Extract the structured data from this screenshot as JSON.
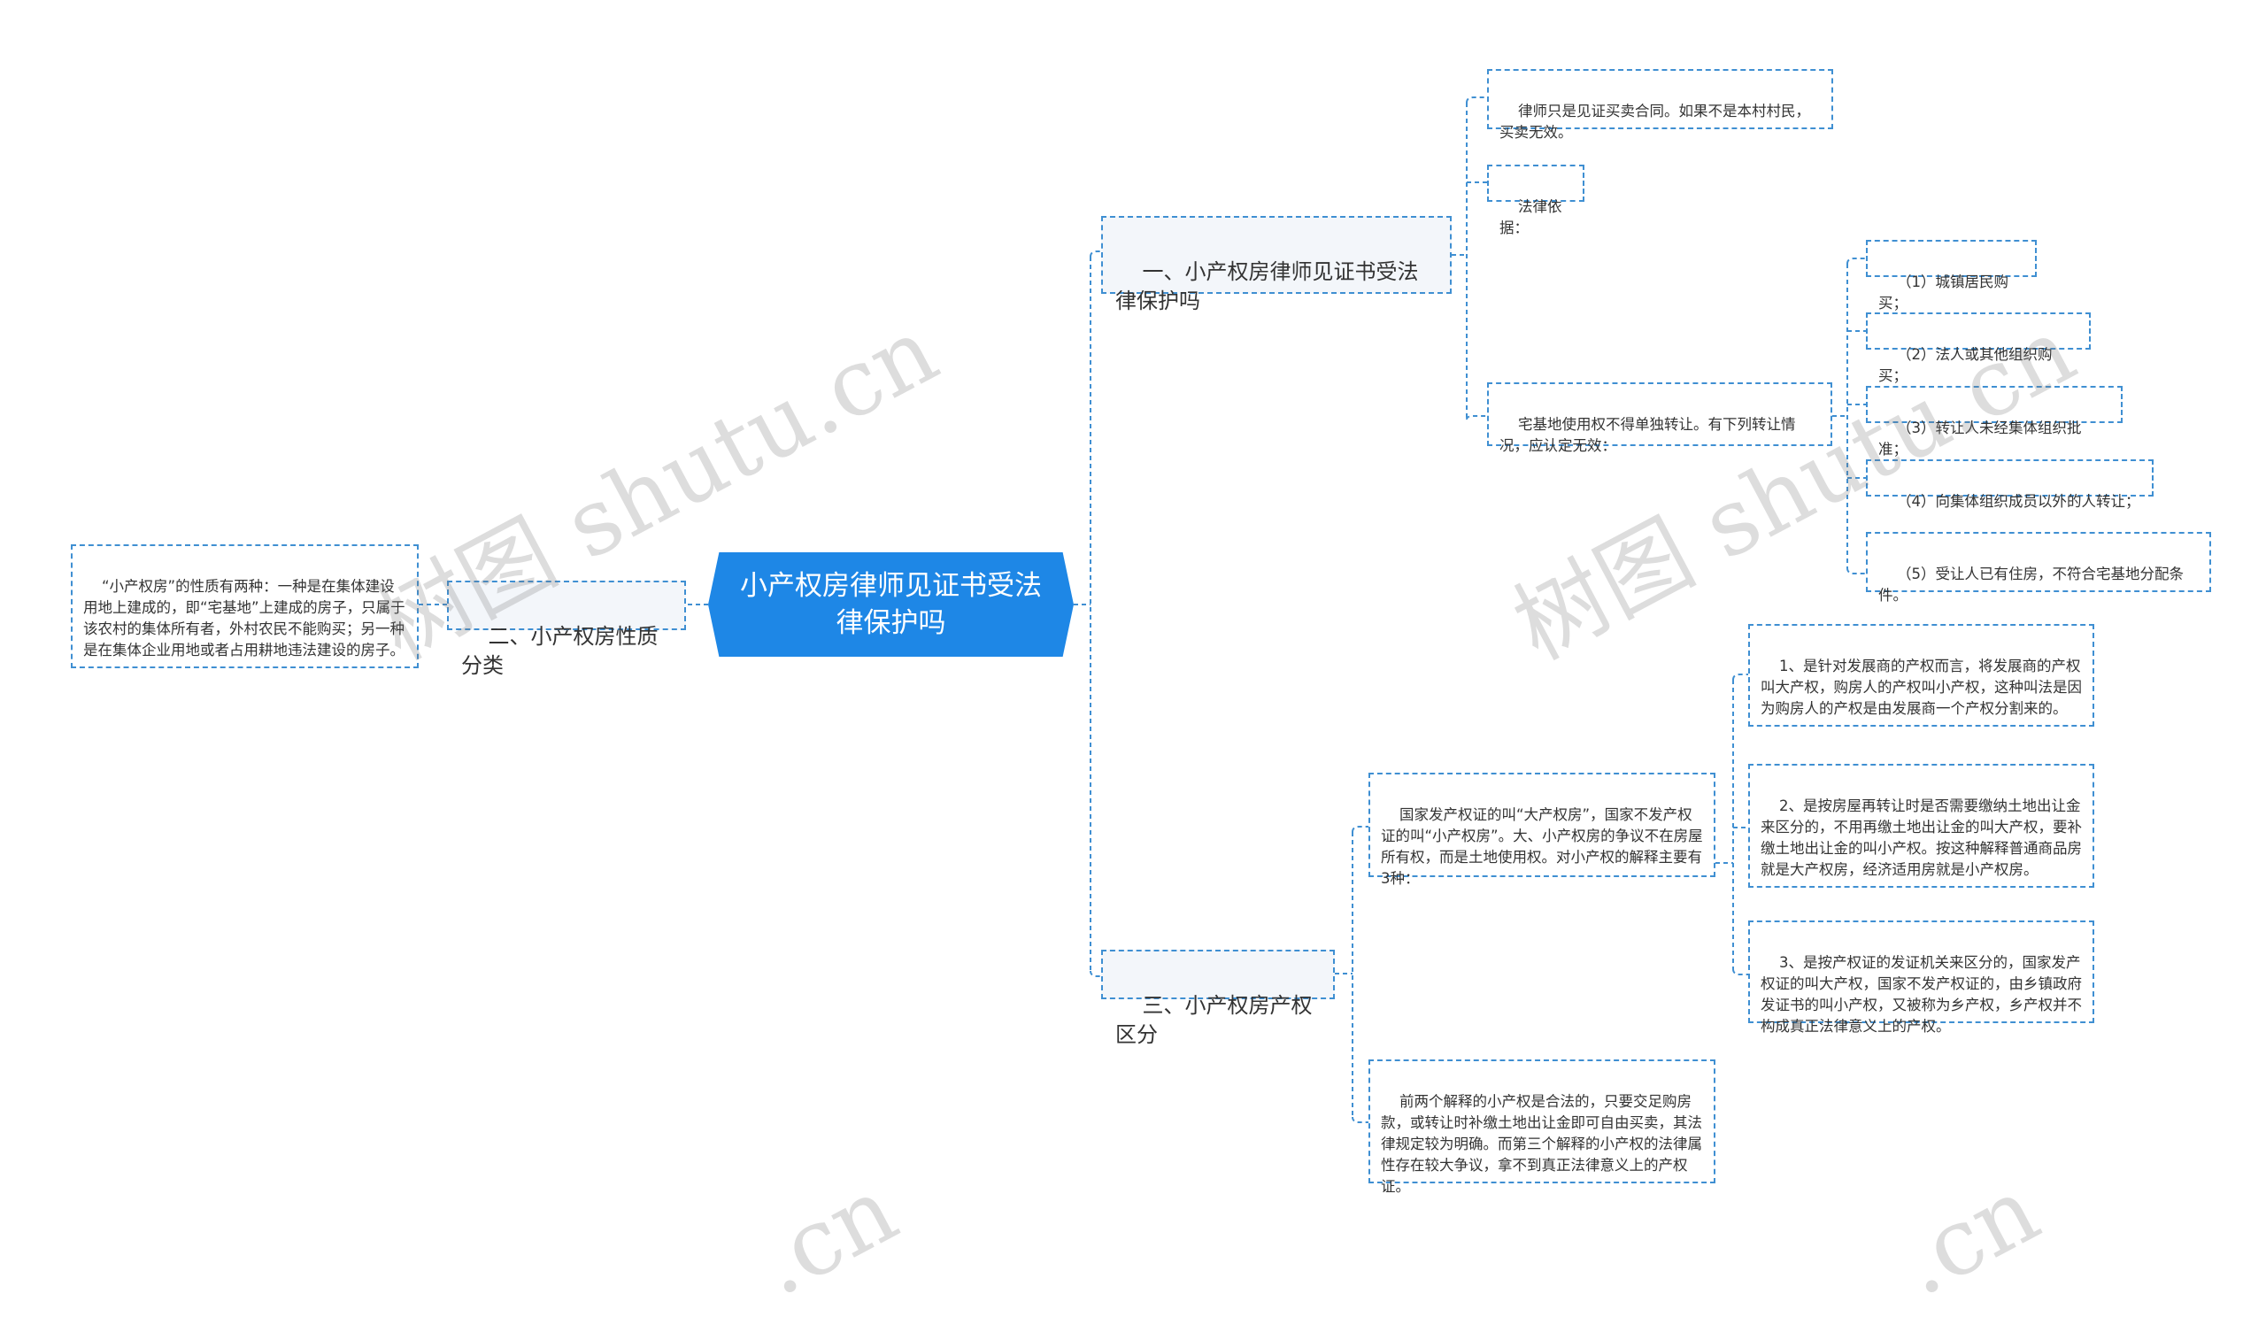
{
  "root": "小产权房律师见证书受法律保护吗",
  "branches": {
    "b1": "一、小产权房律师见证书受法律保护吗",
    "b2": "二、小产权房性质分类",
    "b3": "三、小产权房产权区分"
  },
  "leaves": {
    "b1_note": "律师只是见证买卖合同。如果不是本村村民，买卖无效。",
    "b1_basis": "法律依据：",
    "b1_rule": "宅基地使用权不得单独转让。有下列转让情况，应认定无效：",
    "b1_r1": "（1）城镇居民购买；",
    "b1_r2": "（2）法人或其他组织购买；",
    "b1_r3": "（3）转让人未经集体组织批准；",
    "b1_r4": "（4）向集体组织成员以外的人转让；",
    "b1_r5": "（5）受让人已有住房，不符合宅基地分配条件。",
    "b2_desc": "“小产权房”的性质有两种：一种是在集体建设用地上建成的，即“宅基地”上建成的房子，只属于该农村的集体所有者，外村农民不能购买；另一种是在集体企业用地或者占用耕地违法建设的房子。",
    "b3_intro": "国家发产权证的叫“大产权房”，国家不发产权证的叫“小产权房”。大、小产权房的争议不在房屋所有权，而是土地使用权。对小产权的解释主要有3种：",
    "b3_e1": "1、是针对发展商的产权而言，将发展商的产权叫大产权，购房人的产权叫小产权，这种叫法是因为购房人的产权是由发展商一个产权分割来的。",
    "b3_e2": "2、是按房屋再转让时是否需要缴纳土地出让金来区分的，不用再缴土地出让金的叫大产权，要补缴土地出让金的叫小产权。按这种解释普通商品房就是大产权房，经济适用房就是小产权房。",
    "b3_e3": "3、是按产权证的发证机关来区分的，国家发产权证的叫大产权，国家不发产权证的，由乡镇政府发证书的叫小产权，又被称为乡产权，乡产权并不构成真正法律意义上的产权。",
    "b3_summary": "前两个解释的小产权是合法的，只要交足购房款，或转让时补缴土地出让金即可自由买卖，其法律规定较为明确。而第三个解释的小产权的法律属性存在较大争议，拿不到真正法律意义上的产权证。"
  },
  "watermarks": [
    "树图 shutu.cn",
    "树图 shutu.cn",
    ".cn",
    ".cn"
  ],
  "colors": {
    "root_bg": "#1e87e6",
    "border": "#3f8fd2",
    "link": "#3f8fd2"
  }
}
